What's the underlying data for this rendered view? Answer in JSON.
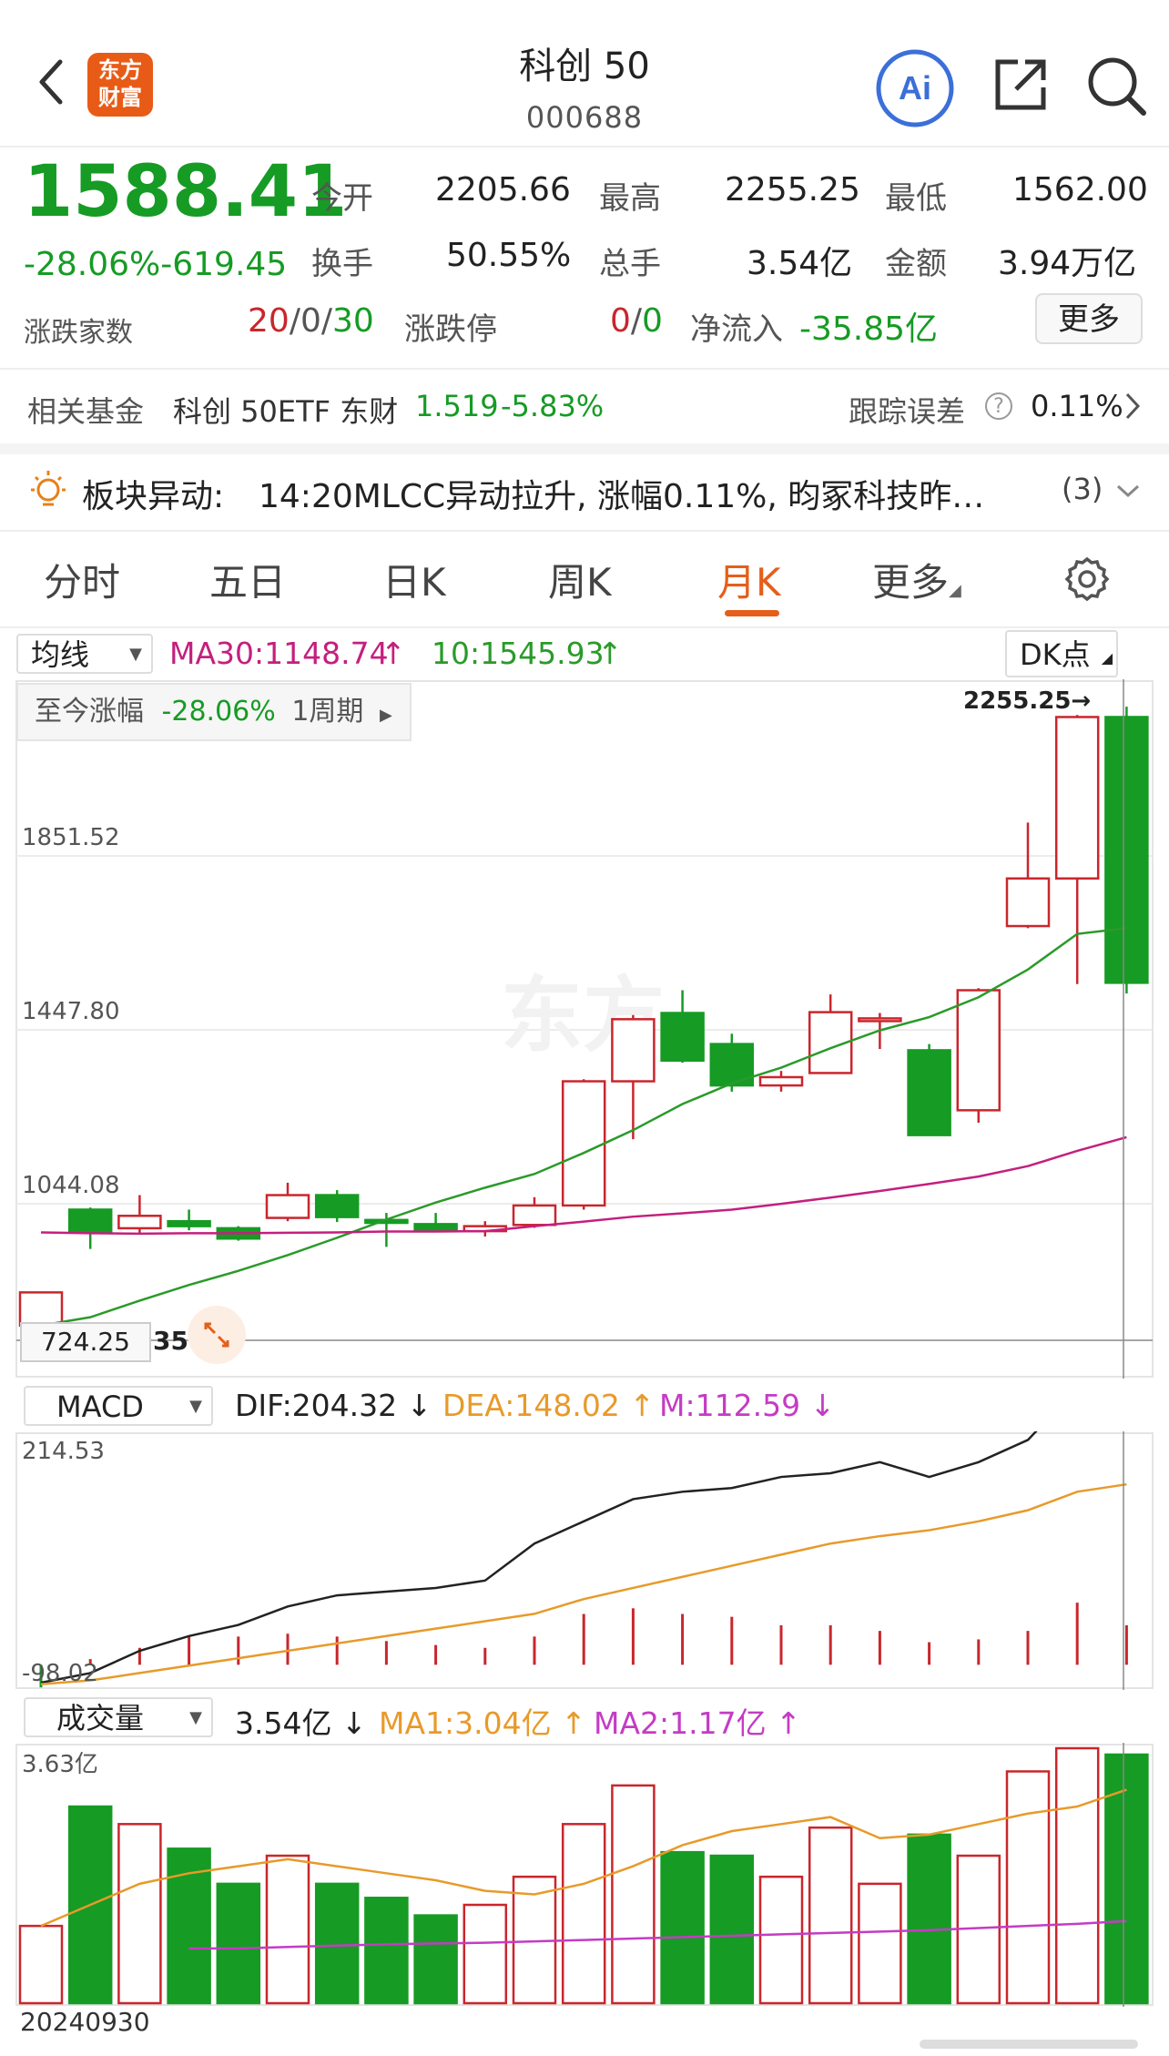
{
  "header": {
    "title": "科创 50",
    "code": "000688",
    "logo_line1": "东方",
    "logo_line2": "财富",
    "ai_label": "Ai"
  },
  "quote": {
    "price": "1588.41",
    "change": "-28.06%-619.45",
    "open_label": "今开",
    "open_value": "2205.66",
    "high_label": "最高",
    "high_value": "2255.25",
    "low_label": "最低",
    "low_value": "1562.00",
    "turnover_label": "换手",
    "turnover_value": "50.55%",
    "volume_label": "总手",
    "volume_value": "3.54亿",
    "amount_label": "金额",
    "amount_value": "3.94万亿",
    "breadth_label": "涨跌家数",
    "breadth_up": "20",
    "breadth_flat": "0",
    "breadth_down": "30",
    "limit_label": "涨跌停",
    "limit_up": "0",
    "limit_down": "0",
    "netflow_label": "净流入",
    "netflow_value": "-35.85亿",
    "more_label": "更多"
  },
  "fund": {
    "label": "相关基金",
    "name": "科创 50ETF 东财",
    "price": "1.519",
    "change": "-5.83%",
    "error_label": "跟踪误差",
    "error_value": "0.11%"
  },
  "alert": {
    "label": "板块异动:",
    "text": "14:20MLCC异动拉升, 涨幅0.11%, 昀冢科技昨…",
    "count": "(3)"
  },
  "tabs": [
    {
      "label": "分时"
    },
    {
      "label": "五日"
    },
    {
      "label": "日K"
    },
    {
      "label": "周K"
    },
    {
      "label": "月K"
    },
    {
      "label": "更多"
    }
  ],
  "main_chart": {
    "indicator_select": "均线",
    "ma30": "MA30:1148.74",
    "ma10": "10:1545.93",
    "dk_label": "DK点",
    "since_label": "至今涨幅",
    "since_value": "-28.06%",
    "period_label": "1周期",
    "high_marker": "2255.25→",
    "y_labels": [
      "1851.52",
      "1447.80",
      "1044.08"
    ],
    "crosshair_price": "724.25",
    "crosshair_extra": "35"
  },
  "macd": {
    "select": "MACD",
    "dif": "DIF:204.32",
    "dea": "DEA:148.02",
    "m": "M:112.59",
    "y_top": "214.53",
    "y_bottom": "-98.02"
  },
  "volume": {
    "select": "成交量",
    "value": "3.54亿",
    "ma1": "MA1:3.04亿",
    "ma2": "MA2:1.17亿",
    "y_top": "3.63亿",
    "date": "20240930"
  },
  "colors": {
    "up": "#c9262c",
    "down": "#169b24",
    "accent": "#e55f1a",
    "ma10": "#2a9a2a",
    "ma30": "#c41f7e",
    "dea": "#e89a2a"
  },
  "chart_data": {
    "type": "candlestick",
    "candles": [
      {
        "o": 760,
        "c": 840,
        "h": 840,
        "l": 760
      },
      {
        "o": 1040,
        "c": 985,
        "h": 1045,
        "l": 945
      },
      {
        "o": 995,
        "c": 1025,
        "h": 1075,
        "l": 980
      },
      {
        "o": 1012,
        "c": 1000,
        "h": 1040,
        "l": 990
      },
      {
        "o": 995,
        "c": 970,
        "h": 1000,
        "l": 965
      },
      {
        "o": 1020,
        "c": 1075,
        "h": 1105,
        "l": 1012
      },
      {
        "o": 1075,
        "c": 1022,
        "h": 1087,
        "l": 1010
      },
      {
        "o": 1015,
        "c": 1008,
        "h": 1032,
        "l": 950
      },
      {
        "o": 1005,
        "c": 990,
        "h": 1032,
        "l": 985
      },
      {
        "o": 988,
        "c": 1000,
        "h": 1012,
        "l": 975
      },
      {
        "o": 1003,
        "c": 1050,
        "h": 1070,
        "l": 996
      },
      {
        "o": 1050,
        "c": 1350,
        "h": 1355,
        "l": 1040
      },
      {
        "o": 1350,
        "c": 1500,
        "h": 1510,
        "l": 1210
      },
      {
        "o": 1515,
        "c": 1400,
        "h": 1570,
        "l": 1395
      },
      {
        "o": 1440,
        "c": 1340,
        "h": 1465,
        "l": 1325
      },
      {
        "o": 1340,
        "c": 1360,
        "h": 1375,
        "l": 1325
      },
      {
        "o": 1370,
        "c": 1517,
        "h": 1560,
        "l": 1370
      },
      {
        "o": 1500,
        "c": 1502,
        "h": 1515,
        "l": 1428
      },
      {
        "o": 1425,
        "c": 1220,
        "h": 1440,
        "l": 1220
      },
      {
        "o": 1280,
        "c": 1570,
        "h": 1575,
        "l": 1250
      },
      {
        "o": 1725,
        "c": 1840,
        "h": 1975,
        "l": 1720
      },
      {
        "o": 1840,
        "c": 2230,
        "h": 2235,
        "l": 1585
      },
      {
        "o": 2230,
        "c": 1588,
        "h": 2255,
        "l": 1562
      }
    ],
    "ma10": [
      760,
      780,
      820,
      858,
      892,
      930,
      972,
      1016,
      1057,
      1093,
      1126,
      1177,
      1232,
      1295,
      1345,
      1383,
      1430,
      1473,
      1505,
      1553,
      1620,
      1706,
      1720
    ],
    "ma30": [
      985,
      983,
      982,
      983,
      983,
      984,
      985,
      987,
      987,
      988,
      1000,
      1011,
      1023,
      1031,
      1040,
      1054,
      1069,
      1085,
      1102,
      1120,
      1145,
      1182,
      1215
    ],
    "ylim": [
      724.25,
      2255.25
    ],
    "macd_dif": [
      -98,
      -85,
      -55,
      -35,
      -20,
      5,
      20,
      25,
      30,
      40,
      90,
      120,
      150,
      160,
      165,
      180,
      185,
      200,
      180,
      200,
      230,
      300,
      290
    ],
    "macd_dea": [
      -100,
      -95,
      -85,
      -75,
      -65,
      -55,
      -45,
      -35,
      -25,
      -15,
      -5,
      15,
      30,
      45,
      60,
      75,
      90,
      100,
      108,
      120,
      135,
      160,
      170
    ],
    "macd_m": [
      -40,
      10,
      30,
      50,
      50,
      55,
      50,
      42,
      35,
      30,
      50,
      90,
      100,
      90,
      85,
      70,
      70,
      60,
      40,
      45,
      60,
      110,
      70
    ],
    "macd_ylim": [
      -98.02,
      214.53
    ],
    "volume": [
      1.1,
      2.8,
      2.55,
      2.2,
      1.7,
      2.1,
      1.7,
      1.5,
      1.25,
      1.4,
      1.8,
      2.55,
      3.1,
      2.15,
      2.1,
      1.8,
      2.5,
      1.7,
      2.4,
      2.1,
      3.3,
      3.63,
      3.54
    ],
    "vol_ma1": [
      1.1,
      1.4,
      1.7,
      1.85,
      1.95,
      2.05,
      1.95,
      1.85,
      1.75,
      1.6,
      1.55,
      1.7,
      1.95,
      2.25,
      2.45,
      2.55,
      2.65,
      2.35,
      2.4,
      2.55,
      2.7,
      2.8,
      3.04
    ],
    "vol_ma2": [
      null,
      null,
      null,
      0.78,
      0.78,
      0.8,
      0.82,
      0.84,
      0.85,
      0.86,
      0.88,
      0.9,
      0.92,
      0.94,
      0.96,
      0.98,
      1.0,
      1.02,
      1.04,
      1.07,
      1.1,
      1.13,
      1.17
    ],
    "vol_ylim": [
      0,
      3.63
    ]
  }
}
